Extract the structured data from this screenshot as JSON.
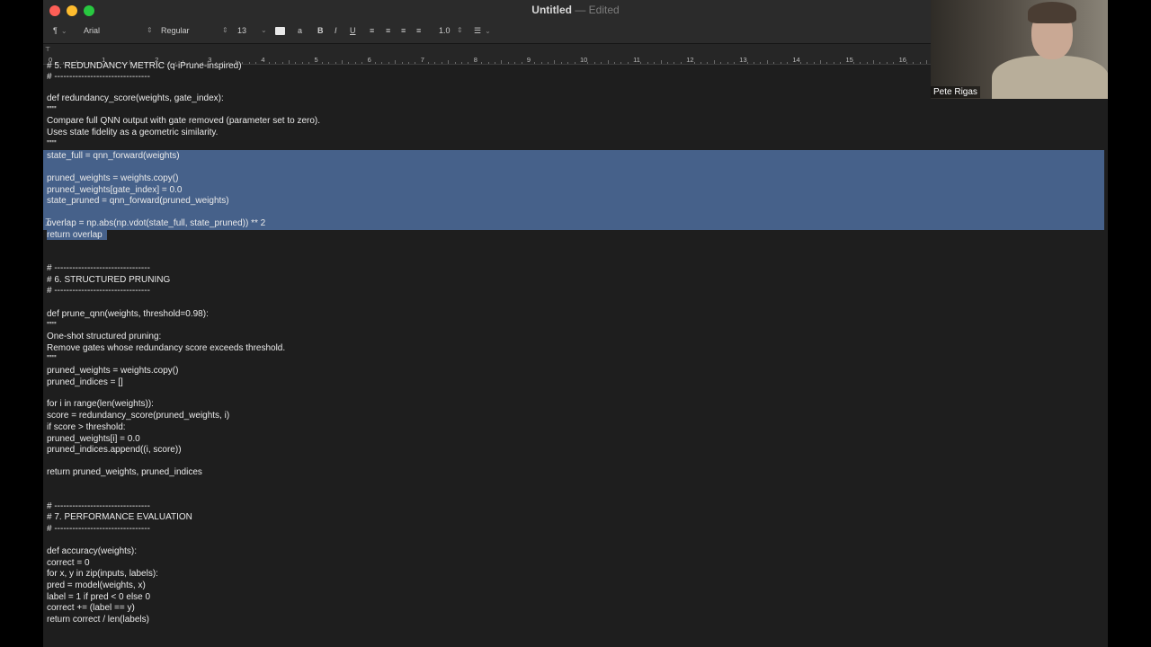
{
  "window": {
    "title": "Untitled",
    "separator": "—",
    "status": "Edited"
  },
  "toolbar": {
    "paragraph_style": "¶",
    "font_family": "Arial",
    "font_style": "Regular",
    "font_size": "13",
    "bold": "B",
    "italic": "I",
    "underline": "U",
    "line_spacing": "1.0",
    "list_icon": "list-icon",
    "text_color_label": "a",
    "colors": {
      "swatch": "#e8e8e8",
      "selection": "#46618a",
      "background": "#1e1e1e"
    }
  },
  "ruler": {
    "labels": [
      "0",
      "1",
      "2",
      "3",
      "4",
      "5",
      "6",
      "7",
      "8",
      "9",
      "10",
      "11",
      "12",
      "13",
      "14",
      "15",
      "16"
    ]
  },
  "video": {
    "participant_name": "Pete Rigas"
  },
  "document": {
    "lines": [
      "# 5. REDUNDANCY METRIC (q-iPrune-inspired)",
      "# --------------------------------",
      "",
      "def redundancy_score(weights, gate_index):",
      "\"\"\"",
      "Compare full QNN output with gate removed (parameter set to zero).",
      "Uses state fidelity as a geometric similarity.",
      "\"\"\"",
      "state_full = qnn_forward(weights)",
      "",
      "pruned_weights = weights.copy()",
      "pruned_weights[gate_index] = 0.0",
      "state_pruned = qnn_forward(pruned_weights)",
      "",
      "overlap = np.abs(np.vdot(state_full, state_pruned)) ** 2",
      "return overlap",
      "",
      "",
      "# --------------------------------",
      "# 6. STRUCTURED PRUNING",
      "# --------------------------------",
      "",
      "def prune_qnn(weights, threshold=0.98):",
      "\"\"\"",
      "One-shot structured pruning:",
      "Remove gates whose redundancy score exceeds threshold.",
      "\"\"\"",
      "pruned_weights = weights.copy()",
      "pruned_indices = []",
      "",
      "for i in range(len(weights)):",
      "score = redundancy_score(pruned_weights, i)",
      "if score > threshold:",
      "pruned_weights[i] = 0.0",
      "pruned_indices.append((i, score))",
      "",
      "return pruned_weights, pruned_indices",
      "",
      "",
      "# --------------------------------",
      "# 7. PERFORMANCE EVALUATION",
      "# --------------------------------",
      "",
      "def accuracy(weights):",
      "correct = 0",
      "for x, y in zip(inputs, labels):",
      "pred = model(weights, x)",
      "label = 1 if pred < 0 else 0",
      "correct += (label == y)",
      "return correct / len(labels)"
    ]
  }
}
